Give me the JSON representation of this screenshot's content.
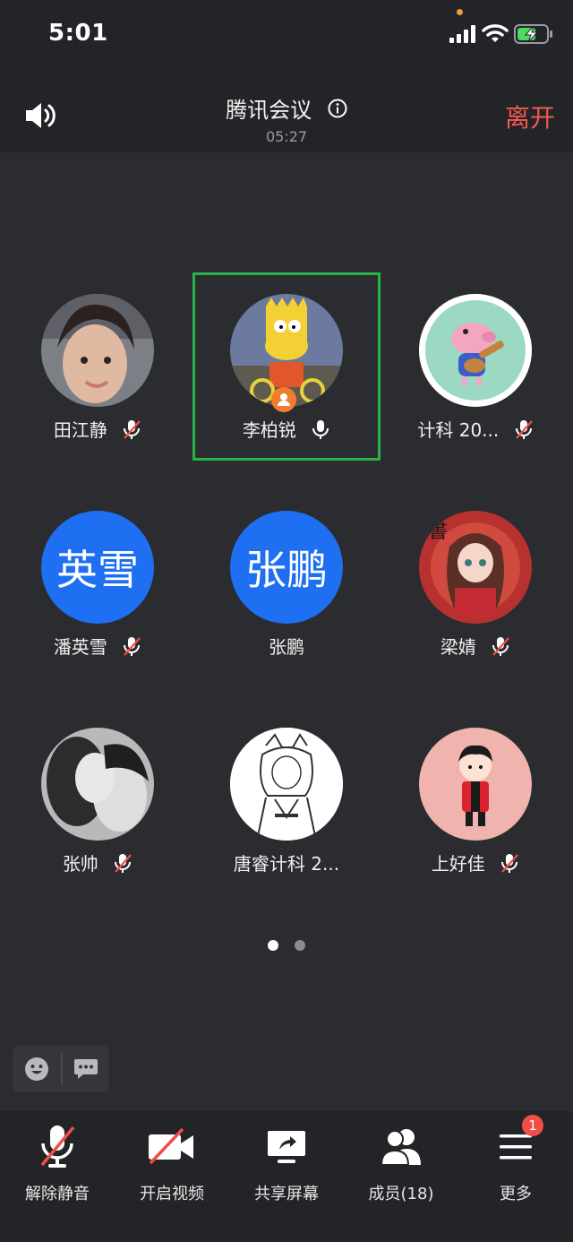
{
  "status_bar": {
    "time": "5:01"
  },
  "header": {
    "title": "腾讯会议",
    "duration": "05:27",
    "leave_label": "离开"
  },
  "participants": [
    {
      "name": "田江静",
      "mic": "muted",
      "avatar": "photo"
    },
    {
      "name": "李柏锐",
      "mic": "on",
      "avatar": "photo",
      "host": true,
      "speaking": true
    },
    {
      "name": "计科 20...",
      "mic": "muted",
      "avatar": "photo"
    },
    {
      "name": "潘英雪",
      "mic": "muted",
      "avatar_text": "英雪"
    },
    {
      "name": "张鹏",
      "mic": "none",
      "avatar_text": "张鹏"
    },
    {
      "name": "梁婧",
      "mic": "muted",
      "avatar": "photo"
    },
    {
      "name": "张帅",
      "mic": "muted",
      "avatar": "photo"
    },
    {
      "name": "唐睿计科 2...",
      "mic": "none",
      "avatar": "photo"
    },
    {
      "name": "上好佳",
      "mic": "muted",
      "avatar": "photo"
    }
  ],
  "pager": {
    "current": 1,
    "total": 2
  },
  "toolbar": {
    "unmute_label": "解除静音",
    "video_label": "开启视频",
    "share_label": "共享屏幕",
    "members_label": "成员(18)",
    "more_label": "更多",
    "more_badge": "1"
  },
  "colors": {
    "accent_blue": "#1f6ff2",
    "leave_red": "#f15a52",
    "active_border": "#28b24b",
    "background": "#2b2c2f"
  }
}
